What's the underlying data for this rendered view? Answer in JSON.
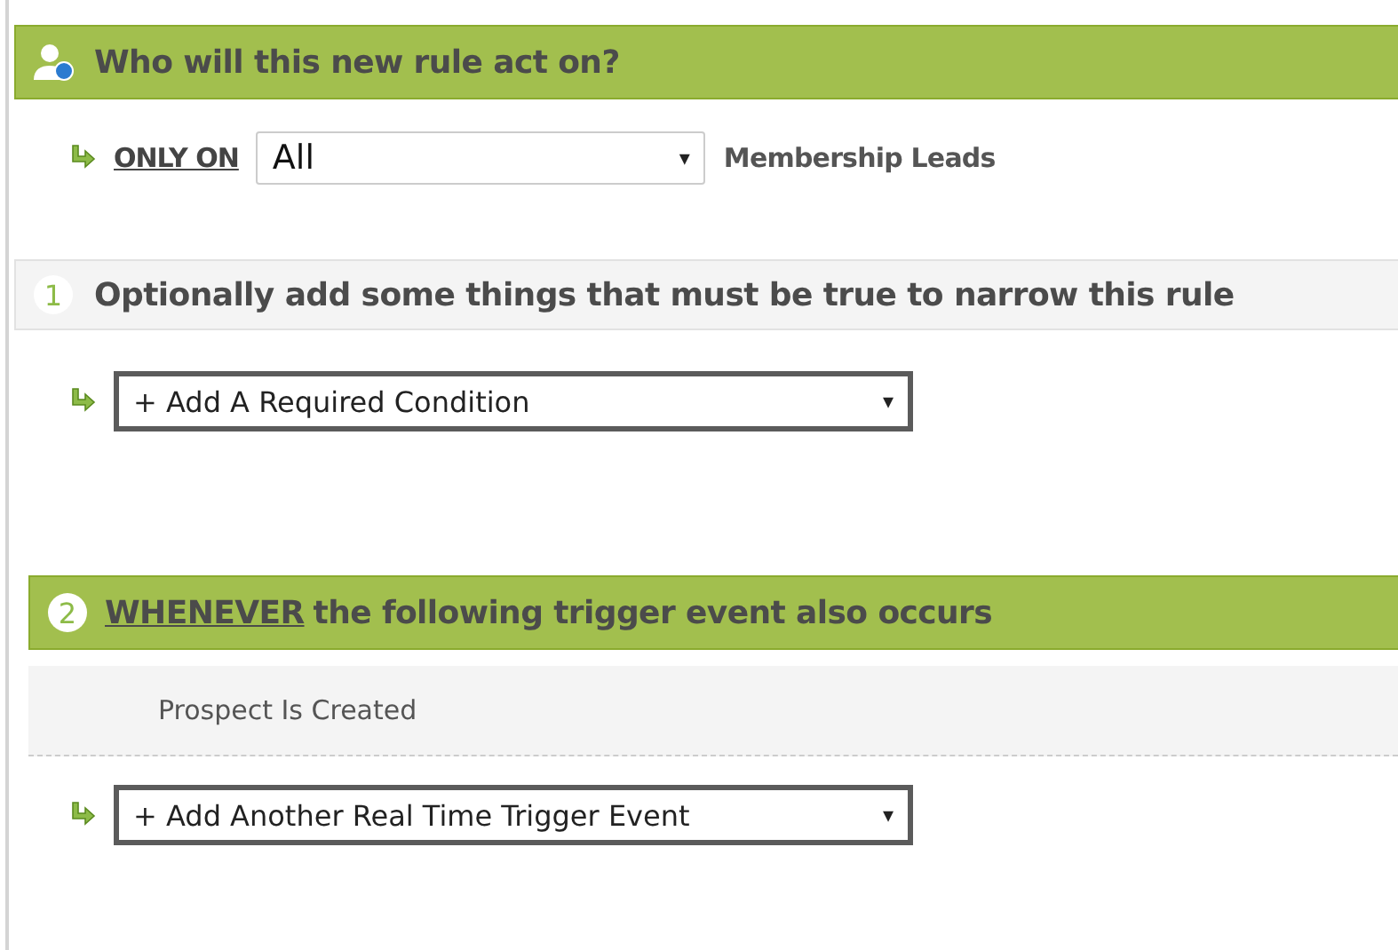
{
  "audience": {
    "title": "Who will this new rule act on?",
    "link": "ONLY ON",
    "select": {
      "value": "All",
      "caret": "▾"
    },
    "suffix": "Membership Leads"
  },
  "conditions": {
    "number": "1",
    "title": "Optionally add some things that must be true to narrow this rule",
    "select": {
      "value": "+ Add A Required Condition",
      "caret": "▾"
    }
  },
  "triggers": {
    "number": "2",
    "link": "WHENEVER",
    "title": "the following trigger event also occurs",
    "events": [
      "Prospect Is Created"
    ],
    "select": {
      "value": "+ Add Another Real Time Trigger Event",
      "caret": "▾"
    }
  }
}
